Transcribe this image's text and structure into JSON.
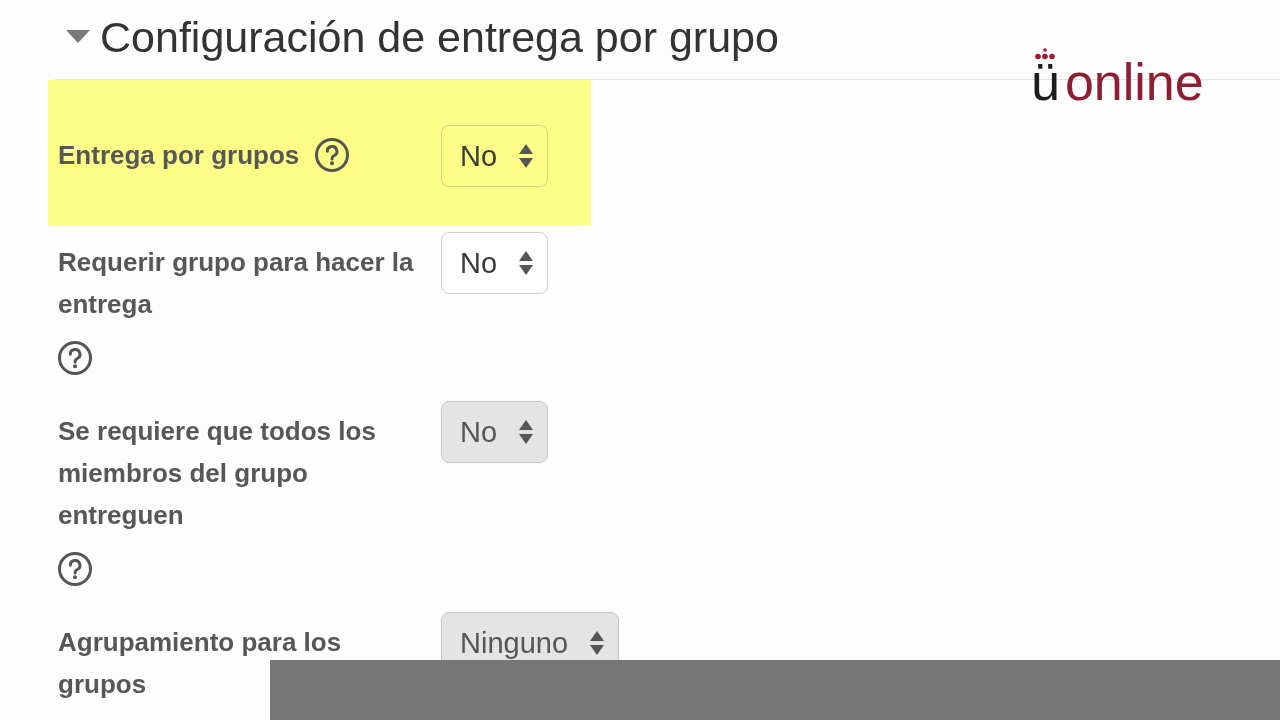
{
  "section": {
    "title": "Configuración de entrega por grupo",
    "expanded": true
  },
  "logo": {
    "initial": "ü",
    "name": "online"
  },
  "fields": [
    {
      "label": "Entrega por grupos",
      "help": true,
      "value": "No",
      "disabled": false,
      "highlighted": true
    },
    {
      "label": "Requerir grupo para hacer la entrega",
      "help": true,
      "value": "No",
      "disabled": false,
      "highlighted": false
    },
    {
      "label": "Se requiere que todos los miembros del grupo entreguen",
      "help": true,
      "value": "No",
      "disabled": true,
      "highlighted": false
    },
    {
      "label": "Agrupamiento para los grupos",
      "help": false,
      "value": "Ninguno",
      "disabled": true,
      "highlighted": false
    }
  ]
}
